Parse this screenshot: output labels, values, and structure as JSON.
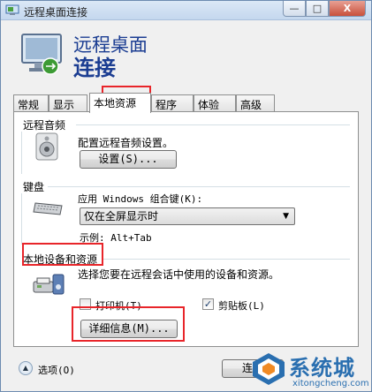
{
  "window": {
    "title": "远程桌面连接",
    "caption": {
      "min": "—",
      "max": "□",
      "close": "X"
    }
  },
  "header": {
    "title_line1": "远程桌面",
    "title_line2": "连接"
  },
  "tabs": [
    {
      "label": "常规"
    },
    {
      "label": "显示"
    },
    {
      "label": "本地资源",
      "active": true
    },
    {
      "label": "程序"
    },
    {
      "label": "体验"
    },
    {
      "label": "高级"
    }
  ],
  "audio": {
    "group_label": "远程音频",
    "description": "配置远程音频设置。",
    "settings_button": "设置(S)...",
    "icon": "speaker-icon"
  },
  "keyboard": {
    "group_label": "键盘",
    "description": "应用 Windows 组合键(K):",
    "selected_option": "仅在全屏显示时",
    "example": "示例: Alt+Tab",
    "icon": "keyboard-icon"
  },
  "local_devices": {
    "group_label": "本地设备和资源",
    "description": "选择您要在远程会话中使用的设备和资源。",
    "printer_label": "打印机(T)",
    "printer_checked": false,
    "clipboard_label": "剪贴板(L)",
    "clipboard_checked": true,
    "details_button": "详细信息(M)...",
    "icon": "devices-icon"
  },
  "footer": {
    "options_label": "选项(O)",
    "connect_button": "连接"
  },
  "watermark": {
    "name": "系统城",
    "url": "xitongcheng.com"
  },
  "colors": {
    "highlight_box": "#e8252a",
    "title_blue": "#1b3d92"
  }
}
